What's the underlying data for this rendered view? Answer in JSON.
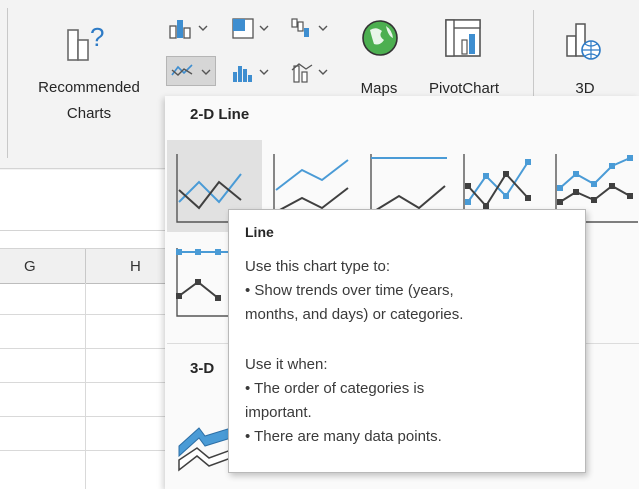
{
  "ribbon": {
    "recommended_charts_label_line1": "Recommended",
    "recommended_charts_label_line2": "Charts",
    "maps_label": "Maps",
    "pivotchart_label": "PivotChart",
    "3d_map_label": "3D",
    "icons": [
      "recommended-charts-icon",
      "column-chart-icon",
      "hierarchy-chart-icon",
      "waterfall-chart-icon",
      "line-chart-icon",
      "statistic-chart-icon",
      "combo-chart-icon",
      "maps-icon",
      "pivotchart-icon",
      "3d-map-icon"
    ]
  },
  "sheet": {
    "columns": [
      "G",
      "H"
    ]
  },
  "dropdown": {
    "section_2d": "2-D Line",
    "section_3d": "3-D",
    "selected_tile": "Line"
  },
  "tooltip": {
    "title": "Line",
    "lines": [
      "Use this chart type to:",
      "• Show trends over time (years,",
      "months, and days) or categories.",
      "",
      "Use it when:",
      "• The order of categories is",
      "important.",
      "• There are many data points."
    ]
  },
  "colors": {
    "accent_blue": "#4a9bd6",
    "dark_line": "#404040",
    "hover_tile": "#e1e1e1"
  }
}
